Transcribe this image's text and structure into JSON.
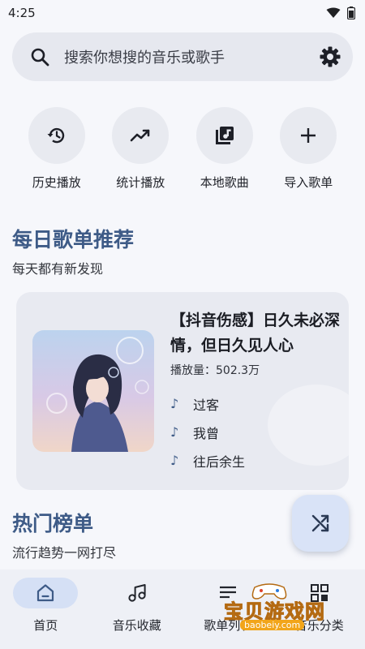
{
  "status_bar": {
    "time": "4:25"
  },
  "search": {
    "placeholder": "搜索你想搜的音乐或歌手"
  },
  "quick_actions": [
    {
      "label": "历史播放",
      "icon": "history-icon"
    },
    {
      "label": "统计播放",
      "icon": "trending-icon"
    },
    {
      "label": "本地歌曲",
      "icon": "library-music-icon"
    },
    {
      "label": "导入歌单",
      "icon": "plus-icon"
    }
  ],
  "daily": {
    "title": "每日歌单推荐",
    "subtitle": "每天都有新发现",
    "card": {
      "title": "【抖音伤感】日久未必深情，但日久见人心",
      "plays": "播放量：502.3万",
      "songs": [
        "过客",
        "我曾",
        "往后余生"
      ]
    }
  },
  "charts": {
    "title": "热门榜单",
    "subtitle": "流行趋势一网打尽"
  },
  "bottom_nav": [
    {
      "label": "首页",
      "icon": "home-icon",
      "active": true
    },
    {
      "label": "音乐收藏",
      "icon": "music-note-icon",
      "active": false
    },
    {
      "label": "歌单列表",
      "icon": "list-icon",
      "active": false
    },
    {
      "label": "音乐分类",
      "icon": "qr-grid-icon",
      "active": false
    }
  ],
  "watermark": {
    "text": "宝贝游戏网",
    "url": "baobeiy.com"
  },
  "colors": {
    "accent": "#3e5b87",
    "background": "#f6f7fb",
    "search_bg": "#e6e8ef",
    "card_bg": "#e8eaf1",
    "nav_active": "#d5e0f5",
    "fab_bg": "#d9e3f7"
  }
}
